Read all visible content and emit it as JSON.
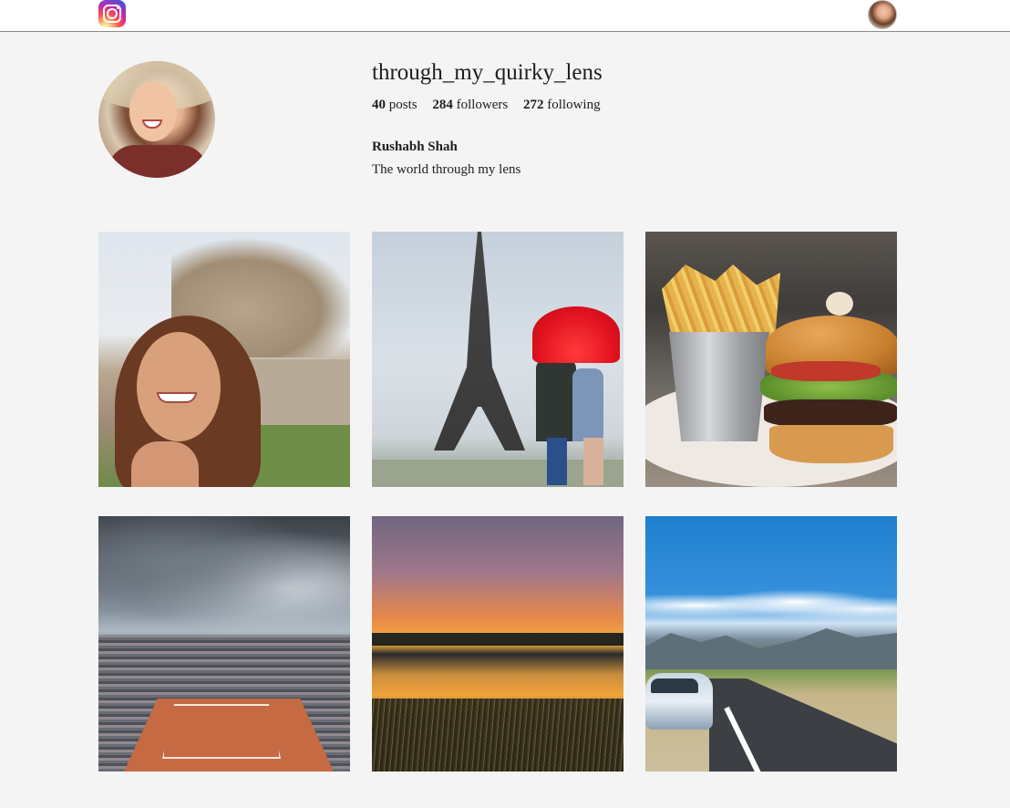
{
  "header": {
    "logo_icon": "instagram-logo-icon",
    "avatar_icon": "user-avatar-icon"
  },
  "profile": {
    "username": "through_my_quirky_lens",
    "stats": {
      "posts_count": "40",
      "posts_label": "posts",
      "followers_count": "284",
      "followers_label": "followers",
      "following_count": "272",
      "following_label": "following"
    },
    "full_name": "Rushabh Shah",
    "bio": "The world through my lens"
  },
  "posts": [
    {
      "subject": "woman-smiling-in-front-of-statue"
    },
    {
      "subject": "eiffel-tower-couple-red-umbrella"
    },
    {
      "subject": "burger-and-fries"
    },
    {
      "subject": "tennis-stadium-clay-court"
    },
    {
      "subject": "sunset-over-lake"
    },
    {
      "subject": "road-with-car-and-mountains"
    }
  ],
  "colors": {
    "page_background": "#f4f4f4",
    "header_background": "#ffffff",
    "header_border": "#8a8a8a",
    "text": "#1e1e1e"
  }
}
